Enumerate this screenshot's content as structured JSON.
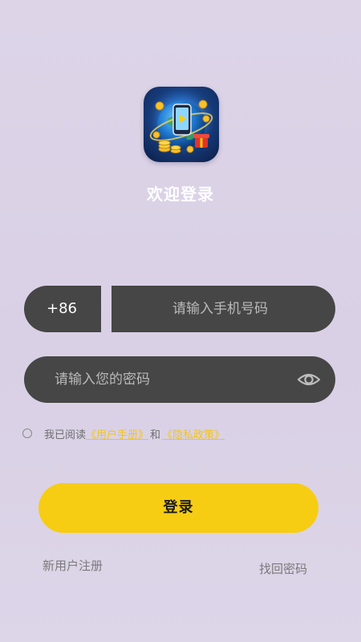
{
  "app": {
    "logo_icon": "earth-phone-coins-icon",
    "welcome_title": "欢迎登录"
  },
  "phone": {
    "country_code": "+86",
    "placeholder": "请输入手机号码",
    "value": ""
  },
  "password": {
    "placeholder": "请输入您的密码",
    "value": "",
    "toggle_icon": "eye-icon"
  },
  "agreement": {
    "prefix": "我已阅读",
    "user_manual": "《用户手册》",
    "conjunction": "和",
    "privacy_policy": "《隐私政策》",
    "checked": false
  },
  "actions": {
    "login_label": "登录",
    "register_label": "新用户注册",
    "forgot_password_label": "找回密码"
  },
  "colors": {
    "background": "#dcd3e6",
    "input_background": "#464646",
    "accent": "#f6cd13",
    "link": "#f3c514",
    "muted_text": "#7a7a7a"
  }
}
